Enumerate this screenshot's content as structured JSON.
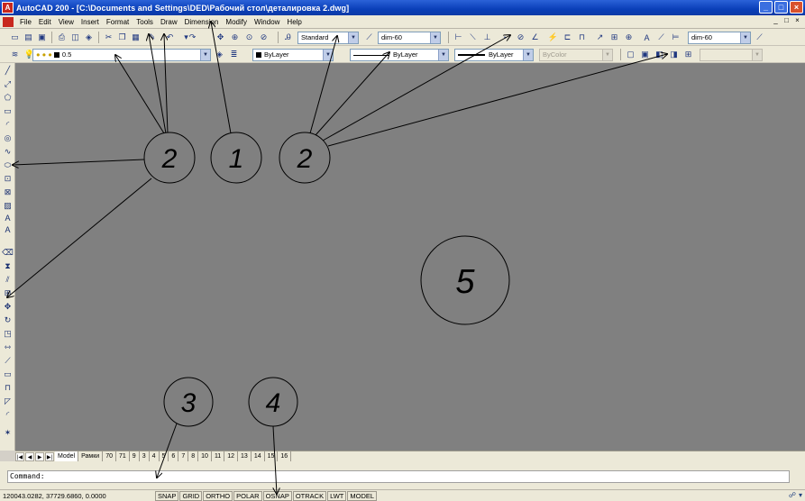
{
  "window": {
    "title": "AutoCAD 200 - [C:\\Documents and Settings\\DED\\Рабочий стол\\деталировка 2.dwg]",
    "controls": [
      "_",
      "□",
      "×"
    ],
    "doc_controls": [
      "_",
      "□",
      "×"
    ]
  },
  "menu": [
    "File",
    "Edit",
    "View",
    "Insert",
    "Format",
    "Tools",
    "Draw",
    "Dimension",
    "Modify",
    "Window",
    "Help"
  ],
  "toolbar_styles": {
    "text_style": "Standard",
    "dim_style": "dim-60",
    "dim_style_right": "dim-60"
  },
  "toolbar_properties": {
    "layer": "0.5",
    "color": "ByLayer",
    "linetype": "ByLayer",
    "lineweight": "ByLayer",
    "plotstyle": "ByColor"
  },
  "tabs": [
    "Model",
    "Рамки",
    "70",
    "71",
    "9",
    "3",
    "4",
    "5",
    "6",
    "7",
    "8",
    "10",
    "11",
    "12",
    "13",
    "14",
    "15",
    "16"
  ],
  "command": {
    "prompt": "Command:"
  },
  "status": {
    "coordinates": "120043.0282, 37729.6860, 0.0000",
    "buttons": [
      "SNAP",
      "GRID",
      "ORTHO",
      "POLAR",
      "OSNAP",
      "OTRACK",
      "LWT",
      "MODEL"
    ]
  },
  "annotations": {
    "labels": [
      "2",
      "1",
      "2",
      "5",
      "3",
      "4"
    ],
    "stroke_color": "#000000"
  },
  "colors": {
    "titlebar": "#0a3fb8",
    "canvas": "#808080",
    "chrome": "#ece9d8"
  }
}
